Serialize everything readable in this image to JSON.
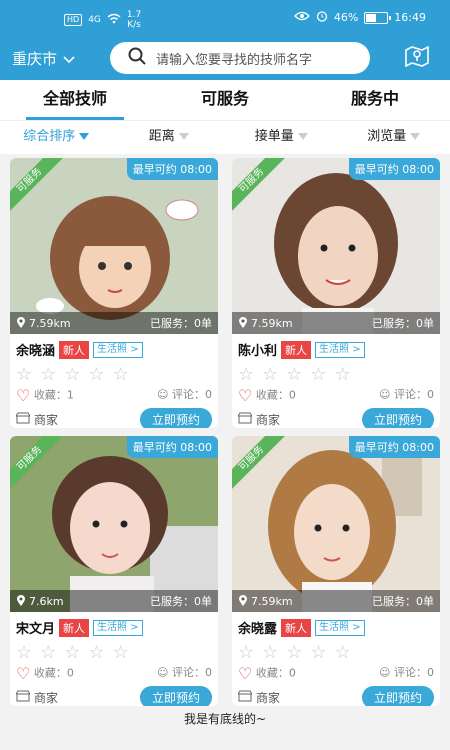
{
  "status_bar": {
    "hd": "HD",
    "signal": "4G",
    "speed": "1.7",
    "speed_unit": "K/s",
    "battery": "46%",
    "time": "16:49"
  },
  "header": {
    "city": "重庆市",
    "search_placeholder": "请输入您要寻找的技师名字",
    "map_icon": "map-pin-icon"
  },
  "tabs": [
    {
      "label": "全部技师"
    },
    {
      "label": "可服务"
    },
    {
      "label": "服务中"
    }
  ],
  "filters": [
    {
      "label": "综合排序"
    },
    {
      "label": "距离"
    },
    {
      "label": "接单量"
    },
    {
      "label": "浏览量"
    }
  ],
  "cards": [
    {
      "name": "余晓涵",
      "ribbon": "可服务",
      "available": "最早可约 08:00",
      "distance": "7.59km",
      "served": "已服务：0单",
      "tag_new": "新人",
      "tag_life": "生活照 >",
      "favorites": "收藏：1",
      "comments": "评论：0",
      "shop": "商家",
      "book": "立即预约"
    },
    {
      "name": "陈小利",
      "ribbon": "可服务",
      "available": "最早可约 08:00",
      "distance": "7.59km",
      "served": "已服务：0单",
      "tag_new": "新人",
      "tag_life": "生活照 >",
      "favorites": "收藏：0",
      "comments": "评论：0",
      "shop": "商家",
      "book": "立即预约"
    },
    {
      "name": "宋文月",
      "ribbon": "可服务",
      "available": "最早可约 08:00",
      "distance": "7.6km",
      "served": "已服务：0单",
      "tag_new": "新人",
      "tag_life": "生活照 >",
      "favorites": "收藏：0",
      "comments": "评论：0",
      "shop": "商家",
      "book": "立即预约"
    },
    {
      "name": "余晓露",
      "ribbon": "可服务",
      "available": "最早可约 08:00",
      "distance": "7.59km",
      "served": "已服务：0单",
      "tag_new": "新人",
      "tag_life": "生活照 >",
      "favorites": "收藏：0",
      "comments": "评论：0",
      "shop": "商家",
      "book": "立即预约"
    }
  ],
  "footer": "我是有底线的~"
}
